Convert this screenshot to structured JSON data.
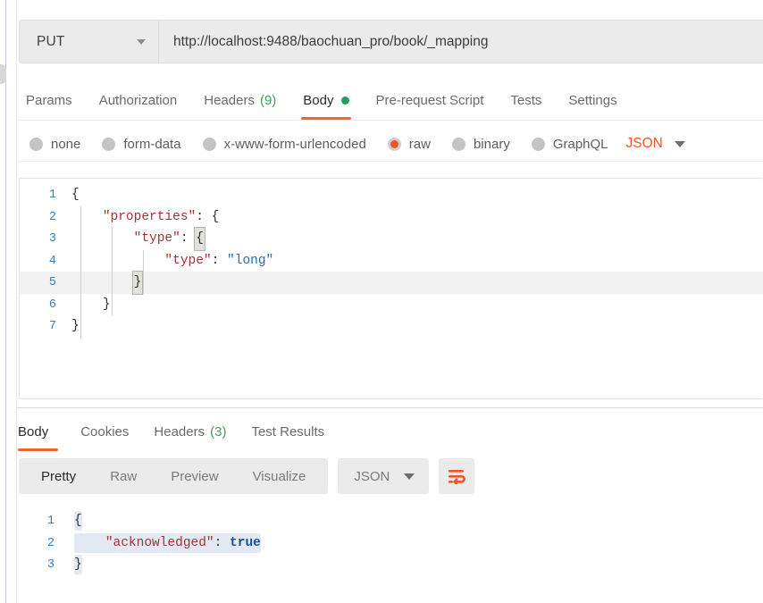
{
  "request": {
    "method": "PUT",
    "method_caret_icon": "chevron-down-icon",
    "url": "http://localhost:9488/baochuan_pro/book/_mapping",
    "tabs": [
      {
        "label": "Params",
        "badge": "",
        "indicator": "",
        "active": false
      },
      {
        "label": "Authorization",
        "badge": "",
        "indicator": "",
        "active": false
      },
      {
        "label": "Headers",
        "badge": "(9)",
        "indicator": "",
        "active": false
      },
      {
        "label": "Body",
        "badge": "",
        "indicator": "dot",
        "active": true
      },
      {
        "label": "Pre-request Script",
        "badge": "",
        "indicator": "",
        "active": false
      },
      {
        "label": "Tests",
        "badge": "",
        "indicator": "",
        "active": false
      },
      {
        "label": "Settings",
        "badge": "",
        "indicator": "",
        "active": false
      }
    ],
    "body_types": [
      {
        "label": "none",
        "selected": false
      },
      {
        "label": "form-data",
        "selected": false
      },
      {
        "label": "x-www-form-urlencoded",
        "selected": false
      },
      {
        "label": "raw",
        "selected": true
      },
      {
        "label": "binary",
        "selected": false
      },
      {
        "label": "GraphQL",
        "selected": false
      }
    ],
    "format": "JSON",
    "format_caret_icon": "chevron-down-icon",
    "body_lines": [
      {
        "n": "1",
        "indent": 0,
        "text": "{",
        "active": false
      },
      {
        "n": "2",
        "indent": 1,
        "text": "\"properties\": {",
        "active": false
      },
      {
        "n": "3",
        "indent": 2,
        "text": "\"type\": {",
        "active": false
      },
      {
        "n": "4",
        "indent": 3,
        "text": "\"type\": \"long\"",
        "active": false
      },
      {
        "n": "5",
        "indent": 2,
        "text": "}",
        "active": true
      },
      {
        "n": "6",
        "indent": 1,
        "text": "}",
        "active": false
      },
      {
        "n": "7",
        "indent": 0,
        "text": "}",
        "active": false
      }
    ],
    "body_raw": "{\n    \"properties\": {\n        \"type\": {\n            \"type\": \"long\"\n        }\n    }\n}"
  },
  "response": {
    "tabs": [
      {
        "label": "Body",
        "badge": "",
        "active": true
      },
      {
        "label": "Cookies",
        "badge": "",
        "active": false
      },
      {
        "label": "Headers",
        "badge": "(3)",
        "active": false
      },
      {
        "label": "Test Results",
        "badge": "",
        "active": false
      }
    ],
    "view_modes": [
      {
        "label": "Pretty",
        "active": true
      },
      {
        "label": "Raw",
        "active": false
      },
      {
        "label": "Preview",
        "active": false
      },
      {
        "label": "Visualize",
        "active": false
      }
    ],
    "format": "JSON",
    "format_caret_icon": "chevron-down-icon",
    "wrap_icon": "word-wrap-icon",
    "body_lines": [
      {
        "n": "1",
        "text": "{"
      },
      {
        "n": "2",
        "text": "\"acknowledged\": true"
      },
      {
        "n": "3",
        "text": "}"
      }
    ],
    "body_raw": "{\n    \"acknowledged\": true\n}",
    "acknowledged_key": "\"acknowledged\"",
    "acknowledged_value": "true"
  },
  "colors": {
    "accent_orange": "#ef6430",
    "radio_orange": "#f0542a",
    "green_dot": "#20a060",
    "badge_green": "#3aa757",
    "gutter_blue": "#3b7fb5",
    "json_string": "#a63232",
    "json_value": "#2a6ca8",
    "selection": "#e3e9f2",
    "toolbar_gray": "#ebebeb"
  }
}
